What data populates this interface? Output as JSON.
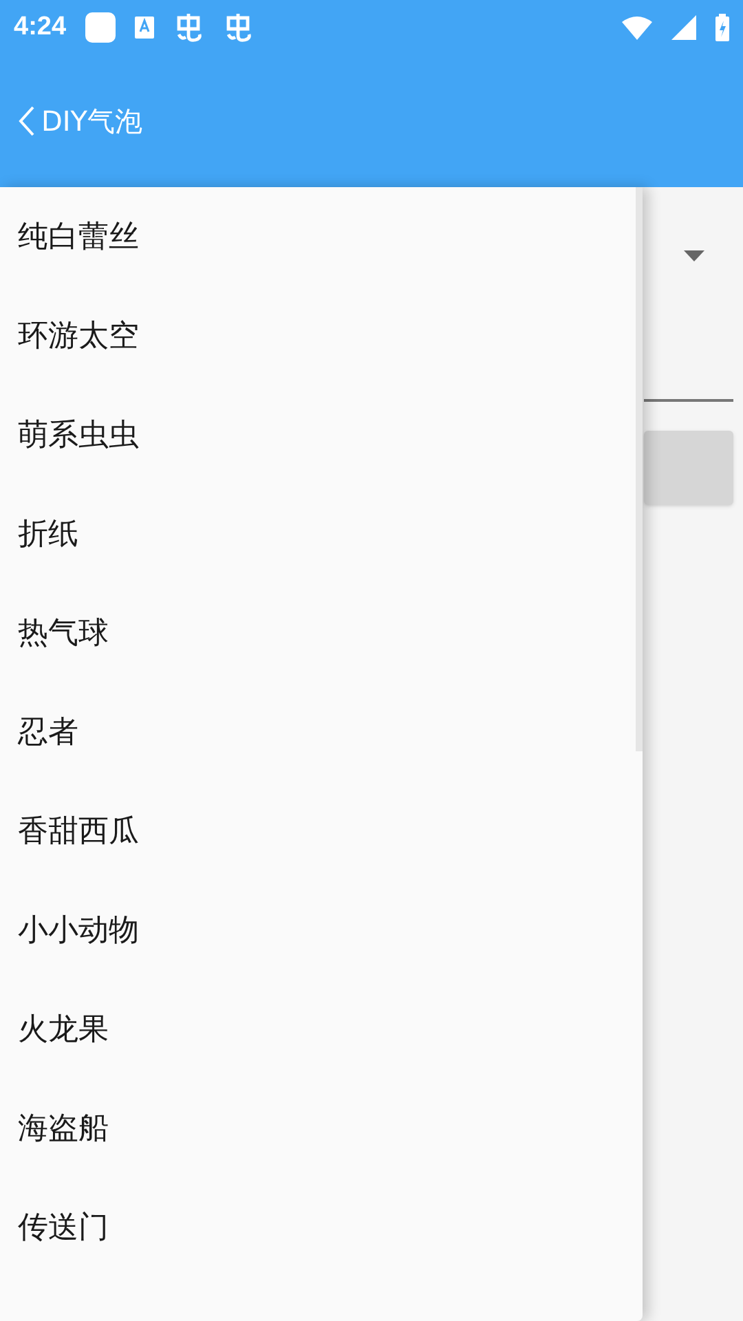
{
  "status_bar": {
    "time": "4:24"
  },
  "app_bar": {
    "title": "DIY气泡"
  },
  "menu": {
    "items": [
      {
        "label": "纯白蕾丝"
      },
      {
        "label": "环游太空"
      },
      {
        "label": "萌系虫虫"
      },
      {
        "label": "折纸"
      },
      {
        "label": "热气球"
      },
      {
        "label": "忍者"
      },
      {
        "label": "香甜西瓜"
      },
      {
        "label": "小小动物"
      },
      {
        "label": "火龙果"
      },
      {
        "label": "海盗船"
      },
      {
        "label": "传送门"
      }
    ]
  }
}
